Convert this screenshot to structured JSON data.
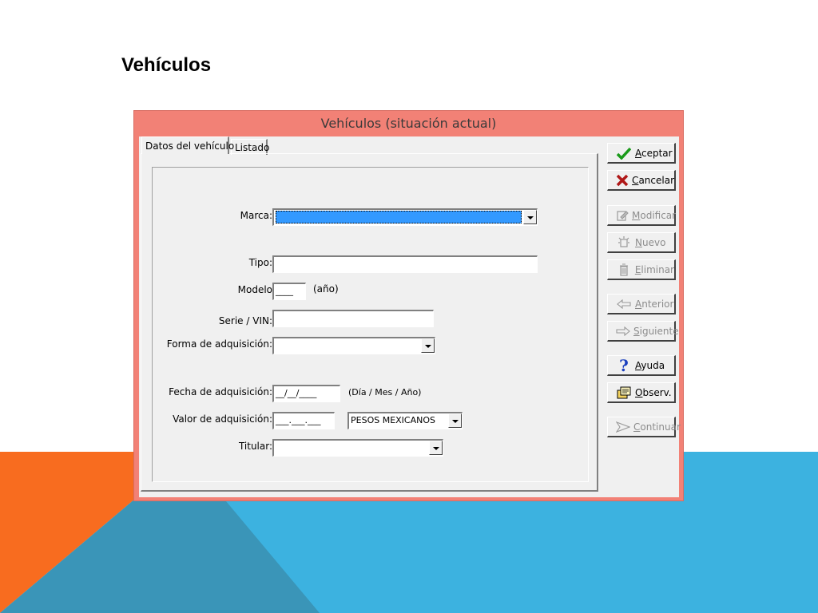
{
  "slide": {
    "title": "Vehículos"
  },
  "window": {
    "title": "Vehículos (situación actual)"
  },
  "tabs": [
    {
      "label": "Datos del vehículo",
      "active": true
    },
    {
      "label": "Listado",
      "active": false
    }
  ],
  "form": {
    "marca": {
      "label": "Marca:",
      "value": ""
    },
    "tipo": {
      "label": "Tipo:",
      "value": ""
    },
    "modelo": {
      "label": "Modelo",
      "value": "____",
      "hint": "(año)"
    },
    "serie": {
      "label": "Serie / VIN:",
      "value": ""
    },
    "forma": {
      "label": "Forma de adquisición:",
      "value": ""
    },
    "fecha": {
      "label": "Fecha de adquisición:",
      "value": "__/__/____",
      "hint": "(Día / Mes / Año)"
    },
    "valor": {
      "label": "Valor de adquisición:",
      "value": "___.___.___",
      "currency": "PESOS MEXICANOS"
    },
    "titular": {
      "label": "Titular:",
      "value": ""
    }
  },
  "buttons": {
    "aceptar": {
      "label": "Aceptar",
      "icon": "check-icon"
    },
    "cancelar": {
      "label": "Cancelar",
      "icon": "x-icon"
    },
    "modificar": {
      "label": "Modificar",
      "icon": "edit-icon"
    },
    "nuevo": {
      "label": "Nuevo",
      "icon": "new-icon"
    },
    "eliminar": {
      "label": "Eliminar",
      "icon": "trash-icon"
    },
    "anterior": {
      "label": "Anterior",
      "icon": "arrow-left-icon"
    },
    "siguiente": {
      "label": "Siguiente",
      "icon": "arrow-right-icon"
    },
    "ayuda": {
      "label": "Ayuda",
      "icon": "help-icon"
    },
    "observ": {
      "label": "Observ.",
      "icon": "notes-icon"
    },
    "continuar": {
      "label": "Continuar",
      "icon": "continue-icon"
    }
  },
  "colors": {
    "window_frame": "#f28176",
    "orange": "#f86c1f",
    "blue": "#3cb2e0",
    "blue_dark": "#3a95b8",
    "selection": "#3399ff"
  }
}
